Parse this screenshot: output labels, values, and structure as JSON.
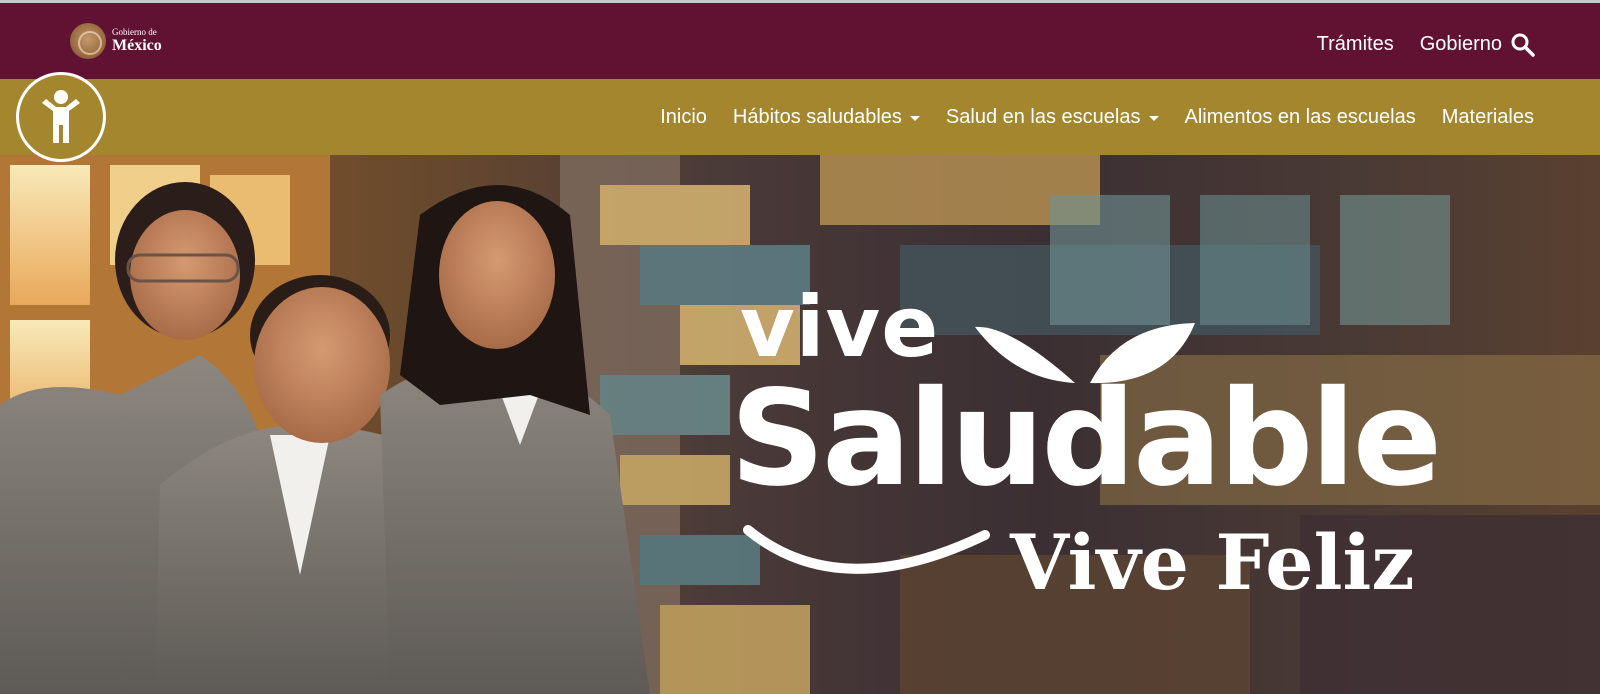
{
  "gov_header": {
    "logo": {
      "icon": "coat-of-arms-seal",
      "line1": "Gobierno de",
      "line2": "México"
    },
    "links": [
      "Trámites",
      "Gobierno"
    ],
    "search_icon": "search-icon"
  },
  "site_nav": {
    "items": [
      {
        "label": "Inicio",
        "has_dropdown": false
      },
      {
        "label": "Hábitos saludables",
        "has_dropdown": true
      },
      {
        "label": "Salud en las escuelas",
        "has_dropdown": true
      },
      {
        "label": "Alimentos en las escuelas",
        "has_dropdown": false
      },
      {
        "label": "Materiales",
        "has_dropdown": false
      }
    ],
    "accessibility_icon": "accessibility-person-icon"
  },
  "hero": {
    "line1": "vive",
    "line2": "Saludable",
    "line3": "Vive Feliz"
  },
  "colors": {
    "gov_bar": "#611232",
    "site_bar": "#a4862f",
    "text_light": "#ffffff"
  }
}
